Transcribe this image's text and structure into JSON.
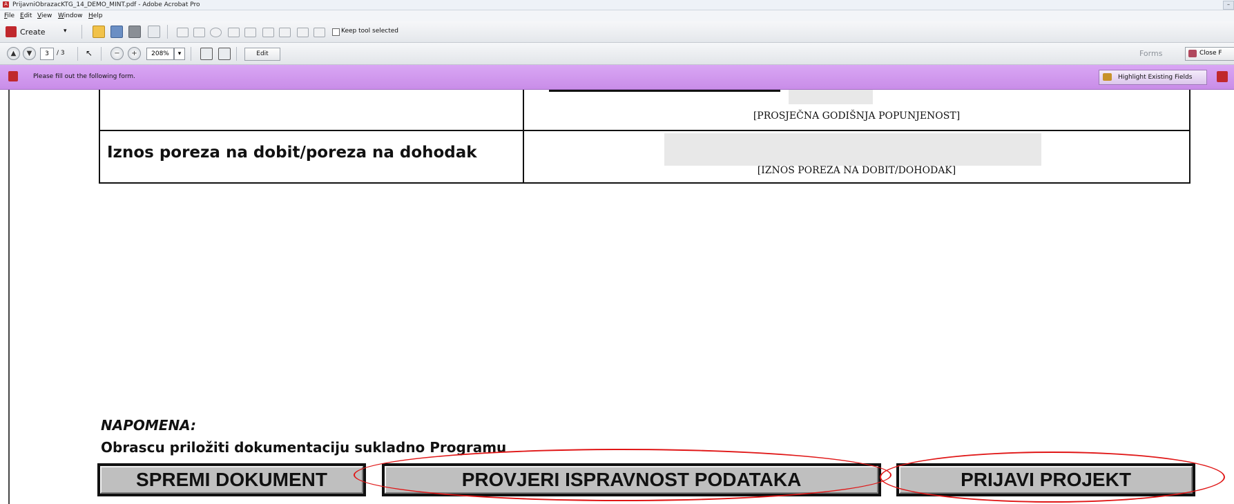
{
  "window": {
    "title": "PrijavniObrazacKTG_14_DEMO_MINT.pdf - Adobe Acrobat Pro"
  },
  "menu": [
    "File",
    "Edit",
    "View",
    "Window",
    "Help"
  ],
  "toolbar": {
    "create_label": "Create",
    "keep_tool_label": "Keep tool selected",
    "page_current": "3",
    "page_total": "/ 3",
    "zoom": "208%",
    "edit_label": "Edit",
    "forms_label": "Forms",
    "close_form_label": "Close F"
  },
  "formbar": {
    "message": "Please fill out the following form.",
    "highlight_label": "Highlight Existing Fields"
  },
  "document": {
    "caption_occupancy": "[PROSJEČNA GODIŠNJA POPUNJENOST]",
    "tax_label": "Iznos poreza na dobit/poreza na  dohodak",
    "caption_tax": "[IZNOS POREZA NA DOBIT/DOHODAK]",
    "note_title": "NAPOMENA:",
    "note_text": "Obrascu priložiti dokumentaciju sukladno Programu",
    "buttons": {
      "save": "SPREMI DOKUMENT",
      "verify": "PROVJERI ISPRAVNOST PODATAKA",
      "submit": "PRIJAVI PROJEKT"
    }
  },
  "colors": {
    "form_bar": "#c98de8",
    "annotation_red": "#e01616",
    "button_gray": "#bfbfbf"
  }
}
